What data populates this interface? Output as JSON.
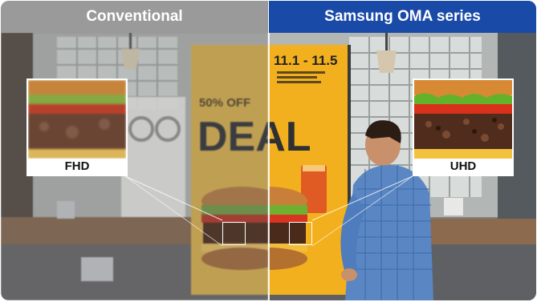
{
  "headers": {
    "conventional": "Conventional",
    "samsung": "Samsung OMA series"
  },
  "poster": {
    "discount": "50% OFF",
    "deal": "DEAL",
    "dates": "11.1 - 11.5"
  },
  "callouts": {
    "left_label": "FHD",
    "right_label": "UHD"
  },
  "colors": {
    "conventional_bar": "#9a9a9a",
    "samsung_bar": "#1a4aa8",
    "poster_yellow": "#f2b01e"
  }
}
